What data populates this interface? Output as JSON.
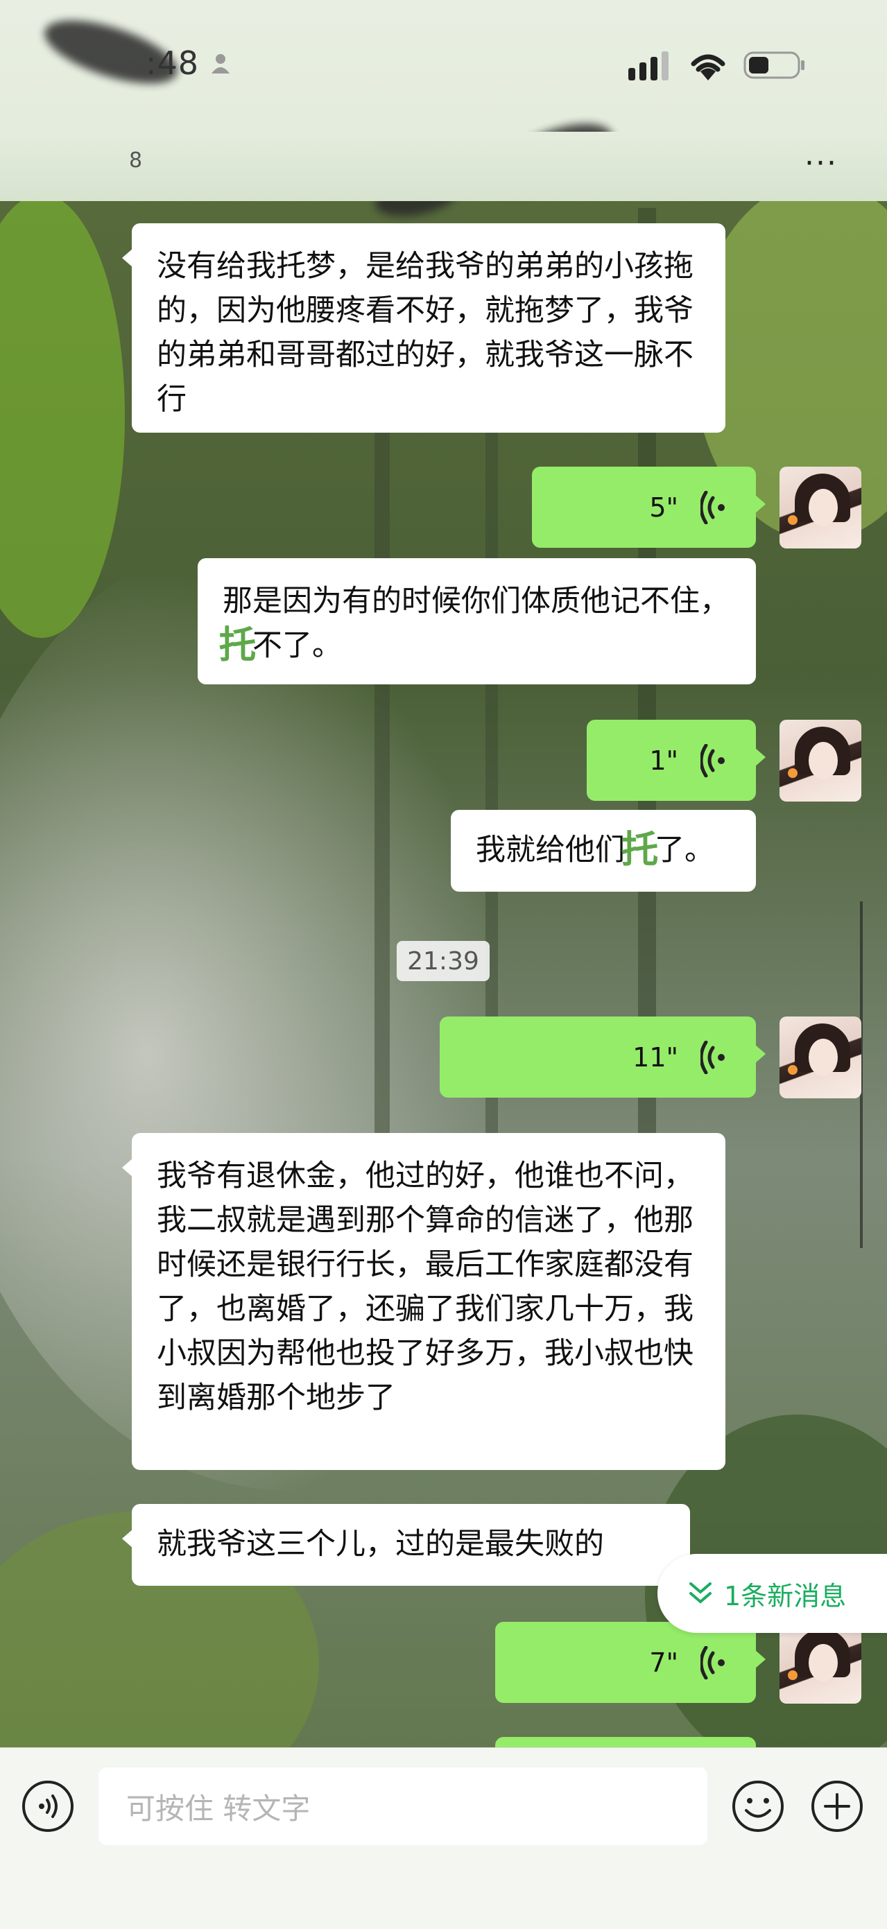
{
  "status_bar": {
    "time": ":48",
    "icons": [
      "person-icon",
      "signal-icon",
      "wifi-icon",
      "battery-icon"
    ]
  },
  "header": {
    "back_text": "8",
    "more_icon": "more-icon"
  },
  "messages": [
    {
      "side": "left",
      "type": "text",
      "text": "没有给我托梦，是给我爷的弟弟的小孩拖的，因为他腰疼看不好，就拖梦了，我爷的弟弟和哥哥都过的好，就我爷这一脉不行"
    },
    {
      "side": "right",
      "type": "voice",
      "duration": "5\""
    },
    {
      "side": "right",
      "type": "text",
      "text_a": "那是因为有的时候你们体质他记不住，",
      "text_overlay": "托",
      "text_b": "不了。"
    },
    {
      "side": "right",
      "type": "voice",
      "duration": "1\""
    },
    {
      "side": "right",
      "type": "text",
      "text_a": "我就给他们",
      "text_overlay": "托",
      "text_b": "了。"
    },
    {
      "type": "timestamp",
      "text": "21:39"
    },
    {
      "side": "right",
      "type": "voice",
      "duration": "11\""
    },
    {
      "side": "left",
      "type": "text",
      "text": "我爷有退休金，他过的好，他谁也不问，我二叔就是遇到那个算命的信迷了，他那时候还是银行行长，最后工作家庭都没有了，也离婚了，还骗了我们家几十万，我小叔因为帮他也投了好多万，我小叔也快到离婚那个地步了"
    },
    {
      "side": "left",
      "type": "text",
      "text": "就我爷这三个儿，过的是最失败的"
    },
    {
      "side": "right",
      "type": "voice",
      "duration": "7\""
    }
  ],
  "new_message_badge": "1条新消息",
  "input_bar": {
    "placeholder": "可按住 转文字",
    "icons": [
      "voice-input-icon",
      "emoji-icon",
      "plus-icon"
    ]
  },
  "colors": {
    "bubble_green": "#95ec69",
    "bubble_white": "#ffffff",
    "badge_text": "#1aad5f"
  }
}
